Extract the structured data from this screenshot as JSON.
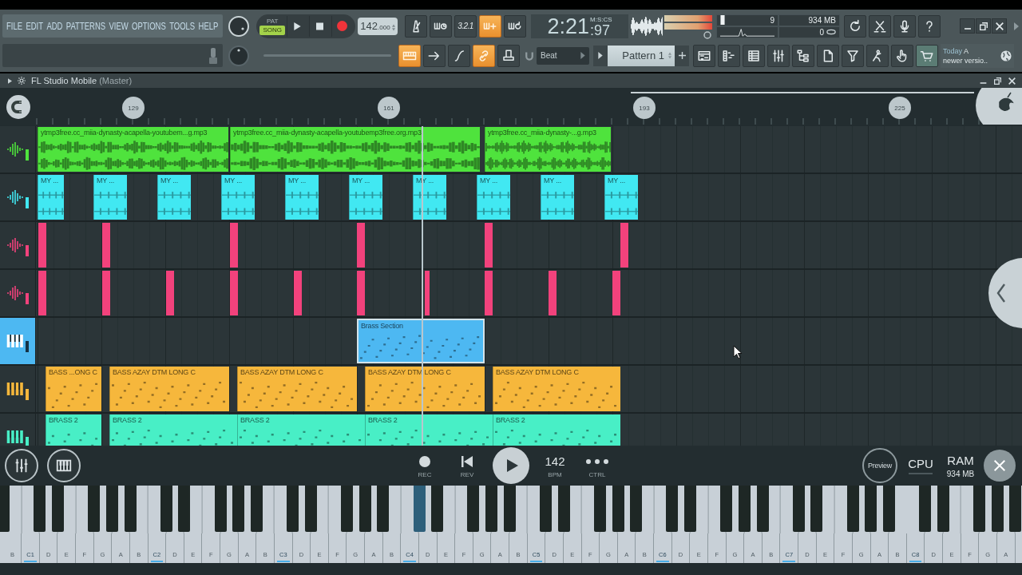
{
  "toolbar": {
    "menu": [
      "FILE",
      "EDIT",
      "ADD",
      "PATTERNS",
      "VIEW",
      "OPTIONS",
      "TOOLS",
      "HELP"
    ],
    "mode": [
      {
        "label": "PAT",
        "selected": false
      },
      {
        "label": "SONG",
        "selected": true
      }
    ],
    "tempo": {
      "whole": "142",
      "fraction": ".000"
    },
    "record_buttons": [
      {
        "kind": "metronome",
        "on": false
      },
      {
        "kind": "wait",
        "on": false
      },
      {
        "kind": "countdown",
        "label": "3.2.1",
        "on": false
      },
      {
        "kind": "step",
        "on": true
      },
      {
        "kind": "loop",
        "on": false
      }
    ],
    "time": {
      "main": "2:21",
      "centiseconds": ":97",
      "unit": "M:S:CS"
    },
    "monitor": {
      "cpu": "9",
      "memory": "934 MB",
      "polyphony": "0"
    },
    "edit_buttons": [
      {
        "kind": "typing-keyboard",
        "on": true
      },
      {
        "kind": "arrow",
        "on": false
      },
      {
        "kind": "blend",
        "on": false
      },
      {
        "kind": "link",
        "on": true
      },
      {
        "kind": "stamp",
        "on": false
      }
    ],
    "snap": "Beat",
    "pattern": "Pattern 1",
    "hint": {
      "date": "Today",
      "lines": [
        "A",
        "newer versio.."
      ]
    }
  },
  "plugin_window": {
    "title": "FL Studio Mobile",
    "subtitle": "(Master)"
  },
  "ruler": {
    "markers": [
      "129",
      "161",
      "193",
      "225"
    ]
  },
  "tracks": [
    {
      "kind": "audio",
      "color": "#4fe33d",
      "selected": false,
      "clips": [
        {
          "name": "ytmp3free.cc_miia-dynasty-acapella-youtubem...g.mp3",
          "selected": false
        },
        {
          "name": "ytmp3free.cc_miia-dynasty-acapella-youtubemp3free.org.mp3",
          "selected": false
        },
        {
          "name": "ytmp3free.cc_miia-dynasty-...g.mp3",
          "selected": false
        }
      ]
    },
    {
      "kind": "audio",
      "color": "#41e8f2",
      "selected": false,
      "clips": [
        {
          "name": "MY ...",
          "selected": false
        },
        {
          "name": "MY ...",
          "selected": false
        },
        {
          "name": "MY ...",
          "selected": false
        },
        {
          "name": "MY ...",
          "selected": false
        },
        {
          "name": "MY ...",
          "selected": false
        },
        {
          "name": "MY ...",
          "selected": false
        },
        {
          "name": "MY ...",
          "selected": false
        },
        {
          "name": "MY ...",
          "selected": false
        },
        {
          "name": "MY ...",
          "selected": false
        },
        {
          "name": "MY ...",
          "selected": false
        }
      ]
    },
    {
      "kind": "audio",
      "color": "#f2427c",
      "selected": false,
      "clips": [
        {
          "selected": false
        },
        {
          "selected": false
        },
        {
          "selected": false
        },
        {
          "selected": false
        },
        {
          "selected": false
        },
        {
          "selected": false
        }
      ]
    },
    {
      "kind": "audio",
      "color": "#f2427c",
      "selected": false,
      "clips": [
        {
          "selected": false
        },
        {
          "selected": false
        },
        {
          "selected": false
        },
        {
          "selected": false
        },
        {
          "selected": false
        },
        {
          "selected": false
        },
        {
          "selected": false
        },
        {
          "selected": false
        },
        {
          "selected": false
        },
        {
          "selected": false
        }
      ]
    },
    {
      "kind": "pattern",
      "color": "#4db8f2",
      "selected": true,
      "clips": [
        {
          "name": "Brass Section",
          "selected": true
        }
      ]
    },
    {
      "kind": "pattern",
      "color": "#f6b73c",
      "selected": false,
      "clips": [
        {
          "name": "BASS ...ONG C",
          "selected": false
        },
        {
          "name": "BASS AZAY DTM LONG C",
          "selected": false
        },
        {
          "name": "BASS AZAY DTM LONG C",
          "selected": false
        },
        {
          "name": "BASS AZAY DTM LONG C",
          "selected": false
        },
        {
          "name": "BASS AZAY DTM LONG C",
          "selected": false
        }
      ]
    },
    {
      "kind": "pattern",
      "color": "#48efc6",
      "selected": false,
      "clips": [
        {
          "name": "BRASS 2",
          "selected": false
        },
        {
          "name": "BRASS 2",
          "selected": false
        },
        {
          "name": "BRASS 2",
          "selected": false
        },
        {
          "name": "BRASS 2",
          "selected": false
        },
        {
          "name": "BRASS 2",
          "selected": false
        }
      ]
    }
  ],
  "transport": {
    "record_label": "REC",
    "rewind_label": "REV",
    "tempo": "142",
    "tempo_label": "BPM",
    "controls_label": "CTRL"
  },
  "status": {
    "preview": "Preview",
    "cpu": "CPU",
    "ram": "RAM",
    "ram_value": "934 MB"
  },
  "keyboard": {
    "white_keys": [
      {
        "label": "B",
        "selected": false
      },
      {
        "label": "C1",
        "selected": false
      },
      {
        "label": "D",
        "selected": false
      },
      {
        "label": "E",
        "selected": false
      },
      {
        "label": "F",
        "selected": false
      },
      {
        "label": "G",
        "selected": false
      },
      {
        "label": "A",
        "selected": false
      },
      {
        "label": "B",
        "selected": false
      },
      {
        "label": "C2",
        "selected": false
      },
      {
        "label": "D",
        "selected": false
      },
      {
        "label": "E",
        "selected": false
      },
      {
        "label": "F",
        "selected": false
      },
      {
        "label": "G",
        "selected": false
      },
      {
        "label": "A",
        "selected": false
      },
      {
        "label": "B",
        "selected": false
      },
      {
        "label": "C3",
        "selected": false
      },
      {
        "label": "D",
        "selected": false
      },
      {
        "label": "E",
        "selected": false
      },
      {
        "label": "F",
        "selected": false
      },
      {
        "label": "G",
        "selected": false
      },
      {
        "label": "A",
        "selected": false
      },
      {
        "label": "B",
        "selected": false
      },
      {
        "label": "C4",
        "selected": false
      },
      {
        "label": "D",
        "selected": false
      },
      {
        "label": "E",
        "selected": false
      },
      {
        "label": "F",
        "selected": false
      },
      {
        "label": "G",
        "selected": false
      },
      {
        "label": "A",
        "selected": false
      },
      {
        "label": "B",
        "selected": false
      },
      {
        "label": "C5",
        "selected": false
      },
      {
        "label": "D",
        "selected": false
      },
      {
        "label": "E",
        "selected": false
      },
      {
        "label": "F",
        "selected": false
      },
      {
        "label": "G",
        "selected": false
      },
      {
        "label": "A",
        "selected": false
      },
      {
        "label": "B",
        "selected": false
      },
      {
        "label": "C6",
        "selected": false
      },
      {
        "label": "D",
        "selected": false
      },
      {
        "label": "E",
        "selected": false
      },
      {
        "label": "F",
        "selected": false
      },
      {
        "label": "G",
        "selected": false
      },
      {
        "label": "A",
        "selected": false
      },
      {
        "label": "B",
        "selected": false
      },
      {
        "label": "C7",
        "selected": false
      },
      {
        "label": "D",
        "selected": false
      },
      {
        "label": "E",
        "selected": false
      },
      {
        "label": "F",
        "selected": false
      },
      {
        "label": "G",
        "selected": false
      },
      {
        "label": "A",
        "selected": false
      },
      {
        "label": "B",
        "selected": false
      },
      {
        "label": "C8",
        "selected": false
      },
      {
        "label": "D",
        "selected": false
      },
      {
        "label": "E",
        "selected": false
      },
      {
        "label": "F",
        "selected": false
      },
      {
        "label": "G",
        "selected": false
      },
      {
        "label": "A",
        "selected": false
      }
    ],
    "black_keys": [
      {
        "selected": false
      },
      {
        "selected": false
      },
      {
        "selected": false
      },
      {
        "selected": false
      },
      {
        "selected": false
      },
      {
        "selected": false
      },
      {
        "selected": false
      },
      {
        "selected": false
      },
      {
        "selected": false
      },
      {
        "selected": false
      },
      {
        "selected": false
      },
      {
        "selected": false
      },
      {
        "selected": false
      },
      {
        "selected": false
      },
      {
        "selected": false
      },
      {
        "selected": false
      },
      {
        "selected": true
      },
      {
        "selected": false
      },
      {
        "selected": false
      },
      {
        "selected": false
      },
      {
        "selected": false
      },
      {
        "selected": false
      },
      {
        "selected": false
      },
      {
        "selected": false
      },
      {
        "selected": false
      },
      {
        "selected": false
      },
      {
        "selected": false
      },
      {
        "selected": false
      },
      {
        "selected": false
      },
      {
        "selected": false
      },
      {
        "selected": false
      },
      {
        "selected": false
      },
      {
        "selected": false
      },
      {
        "selected": false
      },
      {
        "selected": false
      },
      {
        "selected": false
      },
      {
        "selected": false
      },
      {
        "selected": false
      },
      {
        "selected": false
      },
      {
        "selected": false
      },
      {
        "selected": false
      }
    ]
  }
}
